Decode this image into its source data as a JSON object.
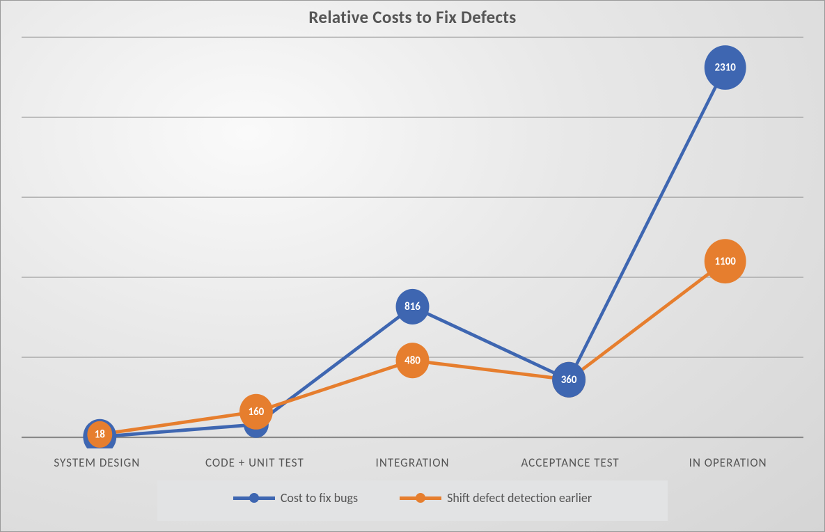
{
  "chart_data": {
    "type": "line",
    "title": "Relative Costs to Fix Defects",
    "categories": [
      "SYSTEM DESIGN",
      "CODE + UNIT TEST",
      "INTEGRATION",
      "ACCEPTANCE TEST",
      "IN OPERATION"
    ],
    "series": [
      {
        "name": "Cost to fix bugs",
        "color": "#3e66b1",
        "values": [
          3.5,
          80,
          816,
          360,
          2310
        ]
      },
      {
        "name": "Shift defect detection earlier",
        "color": "#e67e2e",
        "values": [
          18,
          160,
          480,
          360,
          1100
        ]
      }
    ],
    "xlabel": "",
    "ylabel": "",
    "ylim": [
      0,
      2500
    ],
    "gridlines": [
      0,
      500,
      1000,
      1500,
      2000,
      2500
    ],
    "legend_position": "bottom"
  }
}
